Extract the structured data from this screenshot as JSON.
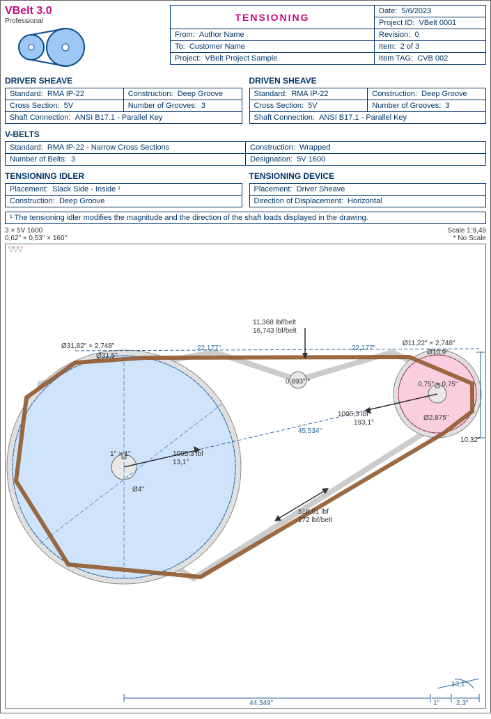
{
  "brand": {
    "title": "VBelt 3.0",
    "subtitle": "Professional"
  },
  "header": {
    "title": "TENSIONING",
    "date_label": "Date:",
    "date": "5/6/2023",
    "project_id_label": "Project ID:",
    "project_id": "VBelt 0001",
    "from_label": "From:",
    "from": "Author Name",
    "revision_label": "Revision:",
    "revision": "0",
    "to_label": "To:",
    "to": "Customer Name",
    "item_label": "Item:",
    "item": "2 of 3",
    "project_label": "Project:",
    "project": "VBelt Project Sample",
    "item_tag_label": "Item TAG:",
    "item_tag": "CVB 002"
  },
  "driver_sheave": {
    "title": "DRIVER SHEAVE",
    "r1l": "Standard:",
    "r1v": "RMA IP-22",
    "r1bl": "Construction:",
    "r1bv": "Deep Groove",
    "r2l": "Cross Section:",
    "r2v": "5V",
    "r2bl": "Number of Grooves:",
    "r2bv": "3",
    "r3l": "Shaft Connection:",
    "r3v": "ANSI B17.1 - Parallel Key"
  },
  "driven_sheave": {
    "title": "DRIVEN SHEAVE",
    "r1l": "Standard:",
    "r1v": "RMA IP-22",
    "r1bl": "Construction:",
    "r1bv": "Deep Groove",
    "r2l": "Cross Section:",
    "r2v": "5V",
    "r2bl": "Number of Grooves:",
    "r2bv": "3",
    "r3l": "Shaft Connection:",
    "r3v": "ANSI B17.1 - Parallel Key"
  },
  "vbelts": {
    "title": "V-BELTS",
    "r1l": "Standard:",
    "r1v": "RMA IP-22 - Narrow Cross Sections",
    "r1bl": "Construction:",
    "r1bv": "Wrapped",
    "r2l": "Number of Belts:",
    "r2v": "3",
    "r2bl": "Designation:",
    "r2bv": "5V 1600"
  },
  "idler": {
    "title": "TENSIONING IDLER",
    "r1l": "Placement:",
    "r1v": "Slack Side - Inside ¹",
    "r2l": "Construction:",
    "r2v": "Deep Groove"
  },
  "device": {
    "title": "TENSIONING DEVICE",
    "r1l": "Placement:",
    "r1v": "Driver Sheave",
    "r2l": "Direction of Displacement:",
    "r2v": "Horizontal"
  },
  "footnote": "¹ The tensioning idler modifies the magnitude and the direction of the shaft loads displayed in the drawing.",
  "drawing": {
    "belt_spec": "3 × 5V 1600",
    "belt_dim": "0,62\" × 0,53\" × 160\"",
    "belt_syms": "▽▽▽",
    "scale_line1": "Scale 1:9,49",
    "scale_line2": "* No Scale",
    "lbl_big_dia_o": "Ø31,82\" × 2,748\"",
    "lbl_big_dia_d": "Ø31,5\"",
    "lbl_top_force1": "11,368 lbf/belt",
    "lbl_top_force2": "16,743 lbf/belt",
    "lbl_top_span1": "22,177\"",
    "lbl_top_span2": "22,177\"",
    "lbl_small_dia_o": "Ø11,22\" × 2,748\"",
    "lbl_small_dia_d": "Ø10,9\"",
    "lbl_defl": "0,693\" *",
    "lbl_small_key": "0,75\" × 0,75\"",
    "lbl_small_shaft": "Ø2,875\"",
    "lbl_right_dim": "10,32\"",
    "lbl_force_r": "1005,3 lbf",
    "lbl_angle_r": "193,1°",
    "lbl_center": "45,534\"",
    "lbl_big_key": "1\" × 1\"",
    "lbl_force_l": "1005,3 lbf",
    "lbl_angle_l": "13,1°",
    "lbl_big_shaft": "Ø4\"",
    "lbl_bot_force1": "516,01 lbf",
    "lbl_bot_force2": "172 lbf/belt",
    "lbl_bottom_dim": "44,349\"",
    "lbl_br_angle": "13,1°",
    "lbl_br_dim1": "1\"",
    "lbl_br_dim2": "2,3\""
  }
}
